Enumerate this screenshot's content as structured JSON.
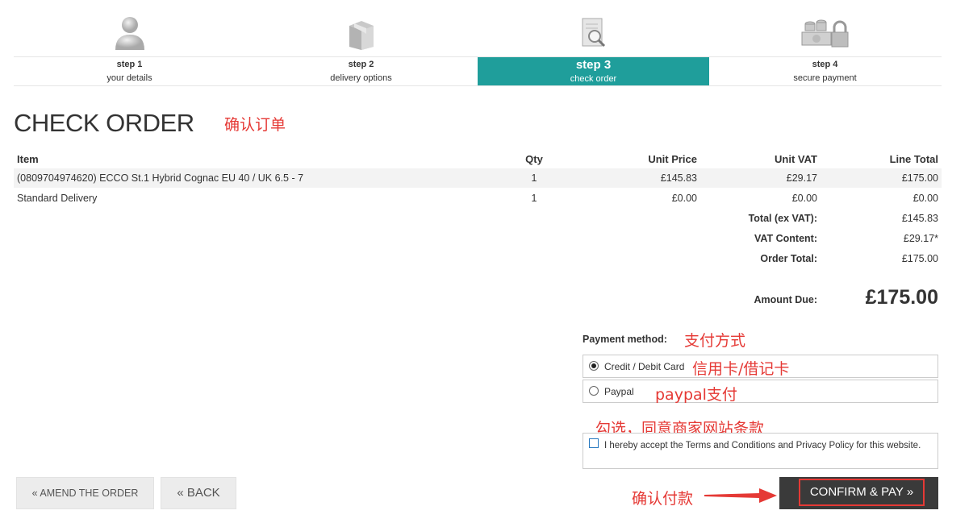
{
  "steps": [
    {
      "num": "step 1",
      "label": "your details",
      "icon": "user-icon",
      "active": false
    },
    {
      "num": "step 2",
      "label": "delivery options",
      "icon": "package-icon",
      "active": false
    },
    {
      "num": "step 3",
      "label": "check order",
      "icon": "document-magnifier-icon",
      "active": true
    },
    {
      "num": "step 4",
      "label": "secure payment",
      "icon": "money-lock-icon",
      "active": false
    }
  ],
  "page_title": "CHECK ORDER",
  "annotations": {
    "title": "确认订单",
    "payment_method": "支付方式",
    "card": "信用卡/借记卡",
    "paypal": "paypal支付",
    "terms": "勾选，同意商家网站条款",
    "confirm": "确认付款"
  },
  "order_table": {
    "headers": {
      "item": "Item",
      "qty": "Qty",
      "unit_price": "Unit Price",
      "unit_vat": "Unit VAT",
      "line_total": "Line Total"
    },
    "rows": [
      {
        "item": "(0809704974620) ECCO St.1 Hybrid Cognac EU 40 / UK 6.5 - 7",
        "qty": "1",
        "unit_price": "£145.83",
        "unit_vat": "£29.17",
        "line_total": "£175.00"
      },
      {
        "item": "Standard Delivery",
        "qty": "1",
        "unit_price": "£0.00",
        "unit_vat": "£0.00",
        "line_total": "£0.00"
      }
    ],
    "totals": [
      {
        "label": "Total (ex VAT):",
        "value": "£145.83"
      },
      {
        "label": "VAT Content:",
        "value": "£29.17*"
      },
      {
        "label": "Order Total:",
        "value": "£175.00"
      }
    ],
    "amount_due_label": "Amount Due:",
    "amount_due_value": "£175.00"
  },
  "payment": {
    "label": "Payment method:",
    "options": [
      {
        "label": "Credit / Debit Card",
        "selected": true
      },
      {
        "label": "Paypal",
        "selected": false
      }
    ]
  },
  "terms": {
    "checked": false,
    "text": "I hereby accept the Terms and Conditions and Privacy Policy for this website."
  },
  "buttons": {
    "amend": "« AMEND THE ORDER",
    "back": "« BACK",
    "confirm": "CONFIRM & PAY »"
  },
  "colors": {
    "accent": "#1f9e9b",
    "annotation": "#e53935",
    "confirm_bg": "#3a3a3a"
  }
}
